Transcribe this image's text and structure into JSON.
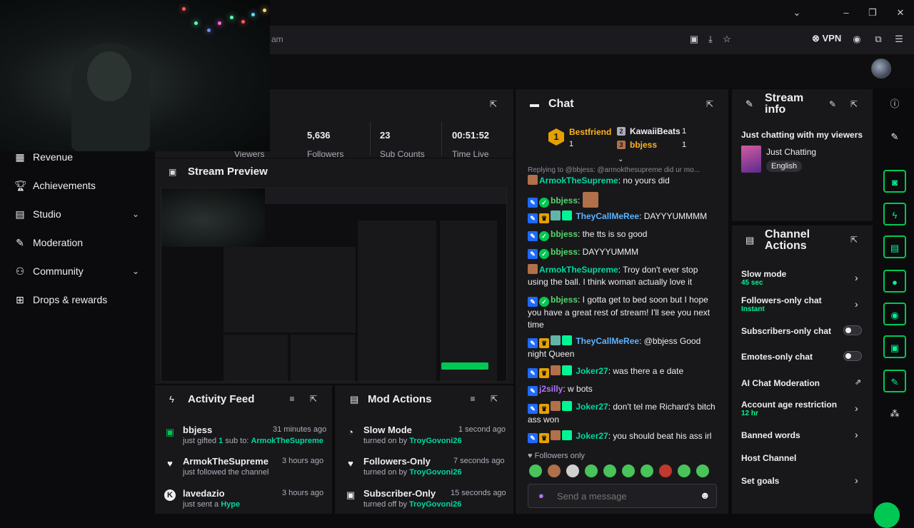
{
  "browser": {
    "url_fragment": "am",
    "vpn_label": "VPN"
  },
  "nav": {
    "items": [
      {
        "label": "Revenue",
        "icon": "chart-icon"
      },
      {
        "label": "Achievements",
        "icon": "trophy-icon"
      },
      {
        "label": "Studio",
        "icon": "studio-icon",
        "expandable": true
      },
      {
        "label": "Moderation",
        "icon": "wrench-icon"
      },
      {
        "label": "Community",
        "icon": "community-icon",
        "expandable": true
      },
      {
        "label": "Drops & rewards",
        "icon": "drops-icon"
      }
    ]
  },
  "stats": {
    "viewers_label": "Viewers",
    "followers_value": "5,636",
    "followers_label": "Followers",
    "subs_value": "23",
    "subs_label": "Sub Counts",
    "time_value": "00:51:52",
    "time_label": "Time Live"
  },
  "stream_preview": {
    "title": "Stream Preview"
  },
  "activity_feed": {
    "title": "Activity Feed",
    "items": [
      {
        "name": "bbjess",
        "time": "31 minutes ago",
        "text": "just gifted",
        "count": "1",
        "text2": "sub to:",
        "target": "ArmokTheSupreme",
        "icon": "gift-icon"
      },
      {
        "name": "ArmokTheSupreme",
        "time": "3 hours ago",
        "text": "just followed the channel",
        "icon": "heart-icon"
      },
      {
        "name": "lavedazio",
        "time": "3 hours ago",
        "text": "just sent a",
        "target": "Hype",
        "icon": "kick-icon"
      }
    ]
  },
  "mod_actions": {
    "title": "Mod Actions",
    "items": [
      {
        "name": "Slow Mode",
        "time": "1 second ago",
        "text": "turned on by",
        "target": "TroyGovoni26",
        "icon": "timer-icon"
      },
      {
        "name": "Followers-Only",
        "time": "7 seconds ago",
        "text": "turned on by",
        "target": "TroyGovoni26",
        "icon": "heart-icon"
      },
      {
        "name": "Subscriber-Only",
        "time": "15 seconds ago",
        "text": "turned off by",
        "target": "TroyGovoni26",
        "icon": "gift-icon"
      }
    ]
  },
  "chat": {
    "title": "Chat",
    "leaderboard": {
      "first_rank": "1",
      "first_name": "Bestfriend",
      "first_count": "1",
      "second_rank": "2",
      "second_name": "KawaiiBeats",
      "second_count": "1",
      "third_rank": "3",
      "third_name": "bbjess",
      "third_count": "1"
    },
    "reply_banner": "Replying to @bbjess: @armokthesupreme did ur mo...",
    "messages": [
      {
        "user": "ArmokTheSupreme",
        "text": ": no yours did"
      },
      {
        "user": "bbjess",
        "text": ":"
      },
      {
        "user": "TheyCallMeRee",
        "text": ": DAYYYUMMMM"
      },
      {
        "user": "bbjess",
        "text": ": the tts is so good"
      },
      {
        "user": "bbjess",
        "text": ": DAYYYUMMM"
      },
      {
        "user": "ArmokTheSupreme",
        "text": ": Troy don't ever stop using the ball. I think woman actually love it"
      },
      {
        "user": "bbjess",
        "text": ": I gotta get to bed soon but I hope you have a great rest of stream! I'll see you next time"
      },
      {
        "user": "TheyCallMeRee",
        "text": ": @bbjess Good night Queen"
      },
      {
        "user": "Joker27",
        "text": ": was there a e date"
      },
      {
        "user": "j2silly",
        "text": ": w bots"
      },
      {
        "user": "Joker27",
        "text": ": don't tel me Richard's bitch ass won"
      },
      {
        "user": "Joker27",
        "text": ": you should beat his ass irl"
      }
    ],
    "followers_only": "Followers only",
    "input_placeholder": "Send a message"
  },
  "stream_info": {
    "title_line1": "Stream",
    "title_line2": "info",
    "stream_title": "Just chatting with my viewers",
    "category": "Just Chatting",
    "tag": "English"
  },
  "channel_actions": {
    "title_line1": "Channel",
    "title_line2": "Actions",
    "items": [
      {
        "label": "Slow mode",
        "sub": "45 sec"
      },
      {
        "label": "Followers-only chat",
        "sub": "Instant"
      },
      {
        "label": "Subscribers-only chat"
      },
      {
        "label": "Emotes-only chat"
      },
      {
        "label": "AI Chat Moderation"
      },
      {
        "label": "Account age restriction",
        "sub": "12 hr"
      },
      {
        "label": "Banned words"
      },
      {
        "label": "Host Channel"
      },
      {
        "label": "Set goals"
      }
    ]
  },
  "colors": {
    "accent": "#00f593",
    "panel": "#18181b",
    "background": "#0b0b0d"
  }
}
